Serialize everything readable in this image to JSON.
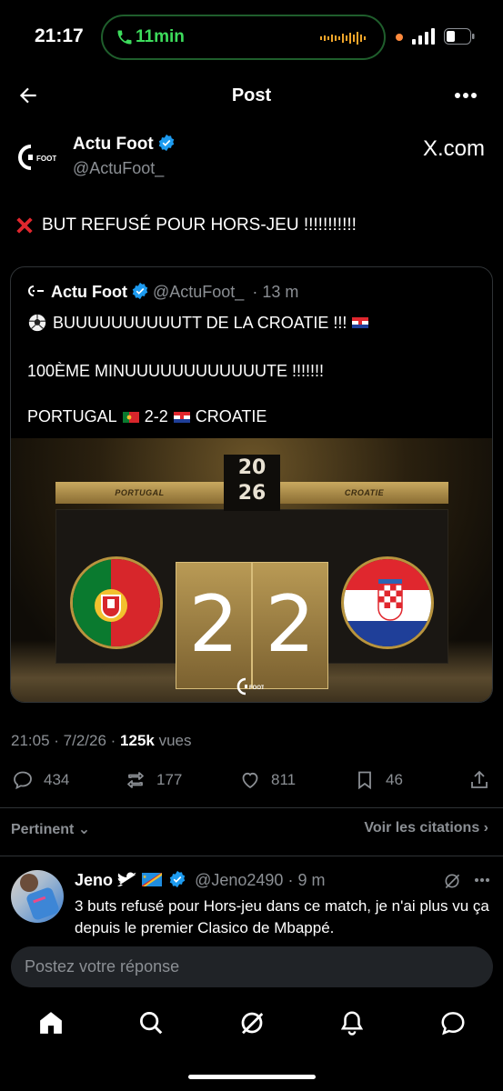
{
  "status_bar": {
    "time": "21:17",
    "call_duration": "11min",
    "call_color": "#3ddc5c"
  },
  "header": {
    "title": "Post",
    "back_icon": "arrow-left-icon",
    "more_icon": "more-horizontal-icon"
  },
  "post": {
    "author_name": "Actu Foot",
    "author_handle": "@ActuFoot_",
    "source_label": "X.com",
    "text": "BUT REFUSÉ POUR HORS-JEU !!!!!!!!!!!",
    "timestamp": "21:05 · 7/2/26 · ",
    "views_count": "125k",
    "views_label": " vues",
    "replies": "434",
    "reposts": "177",
    "likes": "811",
    "bookmarks": "46"
  },
  "quote": {
    "author_name": "Actu Foot",
    "author_handle": "@ActuFoot_",
    "time_ago": "· 13 m",
    "line1": "BUUUUUUUUUUTT DE LA CROATIE !!!",
    "line2": "100ÈME MINUUUUUUUUUUUUTE !!!!!!!",
    "line3_left": "PORTUGAL",
    "line3_score": "2-2",
    "line3_right": "CROATIE",
    "media": {
      "team_left": "PORTUGAL",
      "team_right": "CROATIE",
      "score_left": "2",
      "score_right": "2",
      "year_top": "20",
      "year_bottom": "26"
    }
  },
  "replies_section": {
    "sort_label": "Pertinent",
    "citations_label": "Voir les citations"
  },
  "reply": {
    "name": "Jeno",
    "handle": "@Jeno2490",
    "time_ago": "· 9 m",
    "text": "3 buts refusé pour Hors-jeu dans ce match, je n'ai plus vu ça depuis le premier Clasico de Mbappé."
  },
  "composer": {
    "placeholder": "Postez votre réponse"
  },
  "tabbar": {
    "items": [
      "home-icon",
      "search-icon",
      "grok-icon",
      "notifications-icon",
      "messages-icon"
    ]
  },
  "colors": {
    "background": "#000000",
    "verified": "#1d9bf0",
    "muted": "#8b8f94",
    "divider": "#2f3336"
  }
}
